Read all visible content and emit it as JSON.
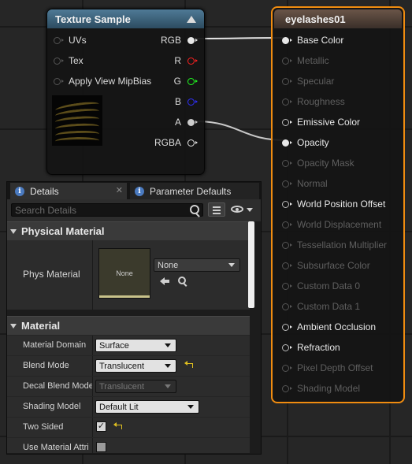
{
  "texture_node": {
    "title": "Texture Sample",
    "inputs": [
      "UVs",
      "Tex",
      "Apply View MipBias"
    ],
    "outputs": [
      {
        "label": "RGB",
        "color": "#ffffff"
      },
      {
        "label": "R",
        "color": "#ff2020"
      },
      {
        "label": "G",
        "color": "#20ff20"
      },
      {
        "label": "B",
        "color": "#3030ff"
      },
      {
        "label": "A",
        "color": "#cccccc"
      },
      {
        "label": "RGBA",
        "color": "#ffffff"
      }
    ]
  },
  "material_node": {
    "title": "eyelashes01",
    "pins": [
      {
        "label": "Base Color",
        "enabled": true,
        "connected": true
      },
      {
        "label": "Metallic",
        "enabled": false
      },
      {
        "label": "Specular",
        "enabled": false
      },
      {
        "label": "Roughness",
        "enabled": false
      },
      {
        "label": "Emissive Color",
        "enabled": true
      },
      {
        "label": "Opacity",
        "enabled": true,
        "connected": true
      },
      {
        "label": "Opacity Mask",
        "enabled": false
      },
      {
        "label": "Normal",
        "enabled": false
      },
      {
        "label": "World Position Offset",
        "enabled": true
      },
      {
        "label": "World Displacement",
        "enabled": false
      },
      {
        "label": "Tessellation Multiplier",
        "enabled": false
      },
      {
        "label": "Subsurface Color",
        "enabled": false
      },
      {
        "label": "Custom Data 0",
        "enabled": false
      },
      {
        "label": "Custom Data 1",
        "enabled": false
      },
      {
        "label": "Ambient Occlusion",
        "enabled": true
      },
      {
        "label": "Refraction",
        "enabled": true
      },
      {
        "label": "Pixel Depth Offset",
        "enabled": false
      },
      {
        "label": "Shading Model",
        "enabled": false
      }
    ]
  },
  "details": {
    "tabs": [
      "Details",
      "Parameter Defaults"
    ],
    "search_placeholder": "Search Details",
    "physical_section": "Physical Material",
    "phys_label": "Phys Material",
    "phys_thumb": "None",
    "phys_value": "None",
    "material_section": "Material",
    "properties": [
      {
        "label": "Material Domain",
        "value": "Surface"
      },
      {
        "label": "Blend Mode",
        "value": "Translucent"
      },
      {
        "label": "Decal Blend Mode",
        "value": "Translucent"
      },
      {
        "label": "Shading Model",
        "value": "Default Lit"
      },
      {
        "label": "Two Sided",
        "checked": true
      },
      {
        "label": "Use Material Attri",
        "checked": false
      }
    ]
  },
  "colors": {
    "accent_selected": "#f08c10",
    "texture_header": "#3d6680",
    "material_header": "#5a4a40"
  }
}
